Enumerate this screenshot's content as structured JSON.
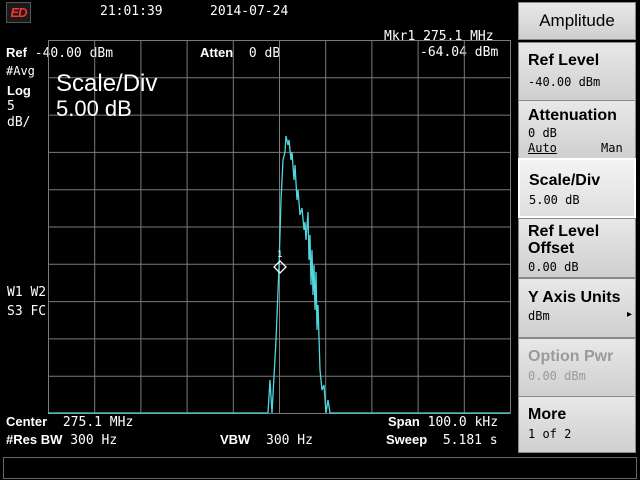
{
  "topbar": {
    "logo": "ED",
    "time": "21:01:39",
    "date": "2014-07-24"
  },
  "display": {
    "marker": {
      "label": "Mkr1 275.1 MHz",
      "value": "-64.04 dBm",
      "symbol": "1"
    },
    "ref_label": "Ref",
    "ref_value": "-40.00 dBm",
    "atten_label": "Atten",
    "atten_value": "0 dB",
    "avg": "#Avg",
    "log": "Log",
    "scale_num": "5",
    "scale_unit": "dB/",
    "annotation_title": "Scale/Div",
    "annotation_value": "5.00 dB",
    "trace_line1": "W1 W2",
    "trace_line2": "S3 FC",
    "center_label": "Center",
    "center_value": "275.1 MHz",
    "span_label": "Span",
    "span_value": "100.0 kHz",
    "rbw_label": "#Res BW",
    "rbw_value": "300 Hz",
    "vbw_label": "VBW",
    "vbw_value": "300 Hz",
    "sweep_label": "Sweep",
    "sweep_value": "5.181 s",
    "trace_color": "#4fd8e0",
    "grid_color": "#7a7a7a"
  },
  "softkeys": {
    "title": "Amplitude",
    "ref_level": {
      "label": "Ref Level",
      "value": "-40.00 dBm"
    },
    "attenuation": {
      "label": "Attenuation",
      "value": "0 dB",
      "auto": "Auto",
      "man": "Man"
    },
    "scale_div": {
      "label": "Scale/Div",
      "value": "5.00 dB"
    },
    "ref_offset": {
      "label1": "Ref Level",
      "label2": "Offset",
      "value": "0.00 dB"
    },
    "y_units": {
      "label": "Y Axis Units",
      "value": "dBm",
      "arrow": "▸"
    },
    "option_pwr": {
      "label": "Option Pwr",
      "value": "0.00 dBm"
    },
    "more": {
      "label": "More",
      "value": "1 of 2"
    }
  },
  "status": {
    "message": ""
  }
}
